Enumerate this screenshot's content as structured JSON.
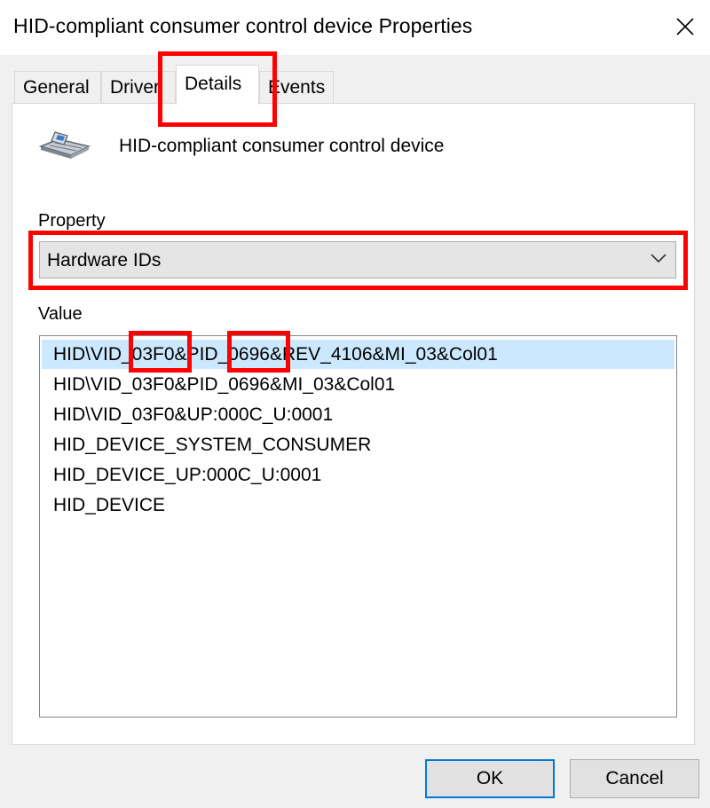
{
  "window": {
    "title": "HID-compliant consumer control device Properties",
    "close_icon": "close-icon"
  },
  "tabs": [
    {
      "label": "General",
      "active": false
    },
    {
      "label": "Driver",
      "active": false
    },
    {
      "label": "Details",
      "active": true
    },
    {
      "label": "Events",
      "active": false
    }
  ],
  "device": {
    "icon": "hid-device-icon",
    "name": "HID-compliant consumer control device"
  },
  "property": {
    "label": "Property",
    "selected": "Hardware IDs",
    "chevron_icon": "chevron-down-icon"
  },
  "value": {
    "label": "Value",
    "items": [
      "HID\\VID_03F0&PID_0696&REV_4106&MI_03&Col01",
      "HID\\VID_03F0&PID_0696&MI_03&Col01",
      "HID\\VID_03F0&UP:000C_U:0001",
      "HID_DEVICE_SYSTEM_CONSUMER",
      "HID_DEVICE_UP:000C_U:0001",
      "HID_DEVICE"
    ],
    "selected_index": 0
  },
  "buttons": {
    "ok": "OK",
    "cancel": "Cancel"
  },
  "colors": {
    "highlight_annotation": "#ff0000",
    "selection": "#cce8ff",
    "default_button_border": "#0078d7"
  }
}
